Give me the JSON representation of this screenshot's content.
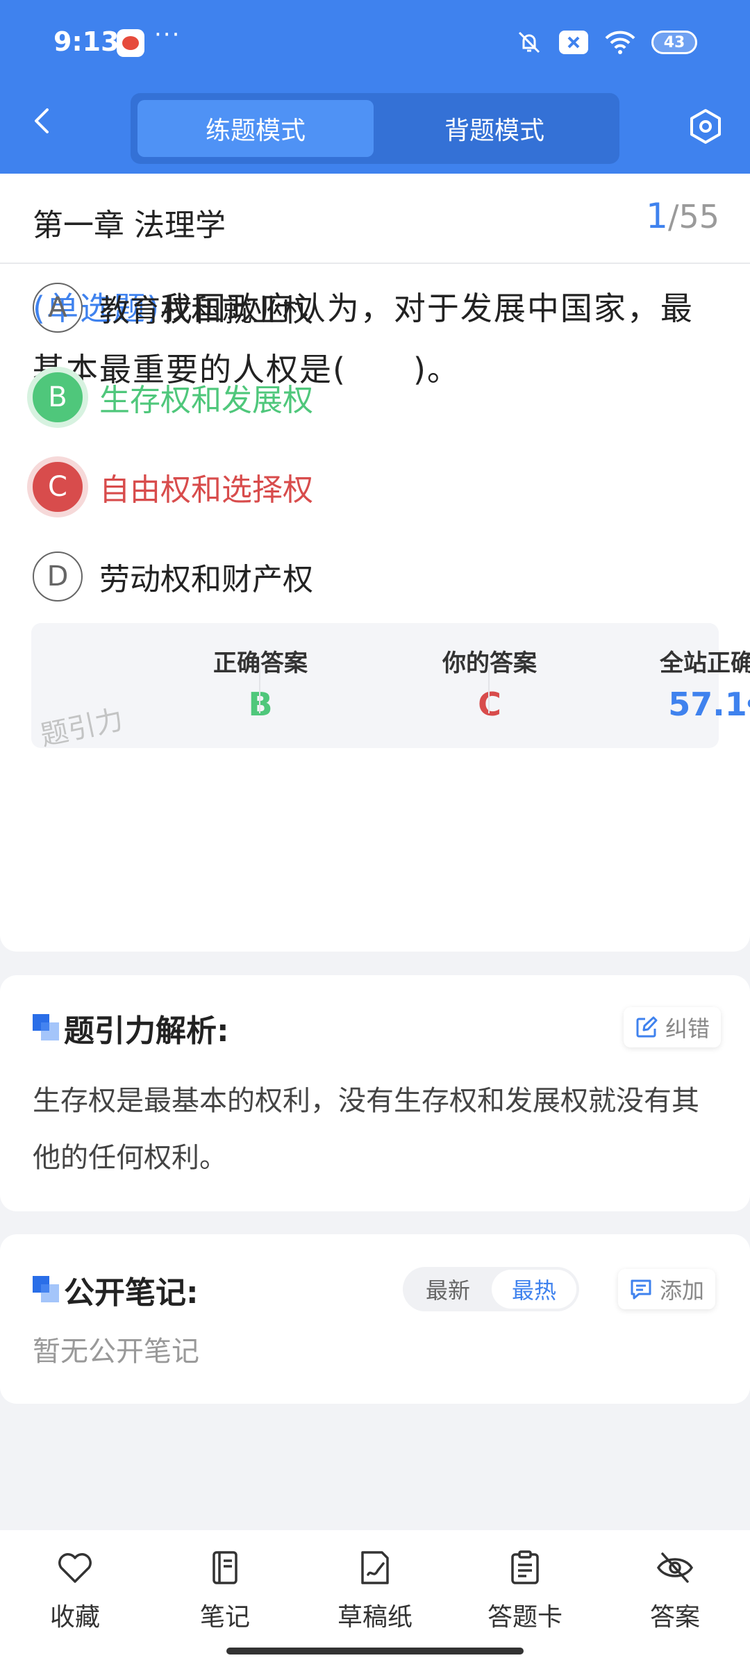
{
  "status_bar": {
    "time": "9:13",
    "more": "···",
    "battery": "43"
  },
  "header": {
    "mode_tabs": [
      "练题模式",
      "背题模式"
    ],
    "active_mode_index": 0
  },
  "question": {
    "chapter": "第一章 法理学",
    "current": "1",
    "separator": "/",
    "total": "55",
    "type_label": "(单选题)",
    "text": "我国政府认为，对于发展中国家，最基本最重要的人权是(　　)。",
    "options": [
      {
        "letter": "A",
        "text": "教育权和就业权",
        "state": "normal"
      },
      {
        "letter": "B",
        "text": "生存权和发展权",
        "state": "correct"
      },
      {
        "letter": "C",
        "text": "自由权和选择权",
        "state": "wrong"
      },
      {
        "letter": "D",
        "text": "劳动权和财产权",
        "state": "normal"
      }
    ]
  },
  "stats": {
    "correct_label": "正确答案",
    "correct_value": "B",
    "yours_label": "你的答案",
    "yours_value": "C",
    "rate_label": "全站正确率",
    "rate_value": "57.1",
    "rate_unit": "%",
    "watermark": "题引力"
  },
  "analysis": {
    "title": "题引力解析:",
    "report_label": "纠错",
    "text": "生存权是最基本的权利，没有生存权和发展权就没有其他的任何权利。"
  },
  "notes": {
    "title": "公开笔记:",
    "sort_options": [
      "最新",
      "最热"
    ],
    "active_sort_index": 1,
    "add_label": "添加",
    "empty_text": "暂无公开笔记"
  },
  "bottom_bar": {
    "items": [
      "收藏",
      "笔记",
      "草稿纸",
      "答题卡",
      "答案"
    ]
  },
  "colors": {
    "primary": "#3f82ee",
    "correct": "#4fc77b",
    "wrong": "#d84c4c"
  }
}
